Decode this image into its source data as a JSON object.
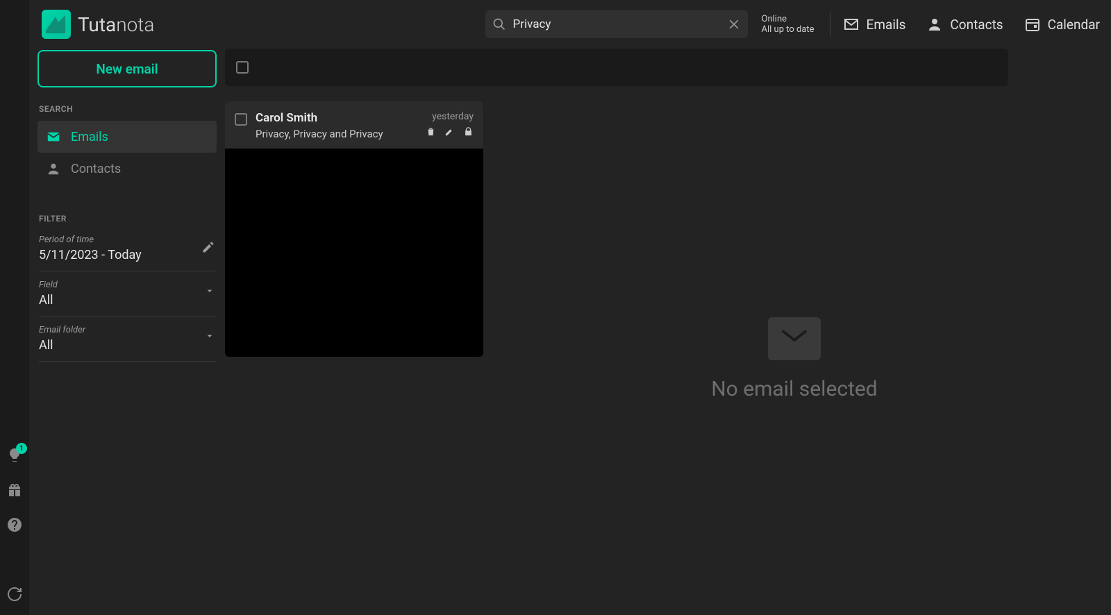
{
  "brand": {
    "name_bold": "Tuta",
    "name_thin": "nota"
  },
  "search": {
    "value": "Privacy"
  },
  "status": {
    "line1": "Online",
    "line2": "All up to date"
  },
  "nav": {
    "emails": "Emails",
    "contacts": "Contacts",
    "calendar": "Calendar"
  },
  "sidebar": {
    "new_email": "New email",
    "section_search": "SEARCH",
    "items": [
      {
        "label": "Emails",
        "active": true
      },
      {
        "label": "Contacts",
        "active": false
      }
    ],
    "section_filter": "FILTER",
    "filters": {
      "period_label": "Period of time",
      "period_value": "5/11/2023 - Today",
      "field_label": "Field",
      "field_value": "All",
      "folder_label": "Email folder",
      "folder_value": "All"
    }
  },
  "results": [
    {
      "sender": "Carol Smith",
      "subject": "Privacy, Privacy and Privacy",
      "time": "yesterday"
    }
  ],
  "detail": {
    "empty_message": "No email selected"
  },
  "rail_badge_count": "1"
}
